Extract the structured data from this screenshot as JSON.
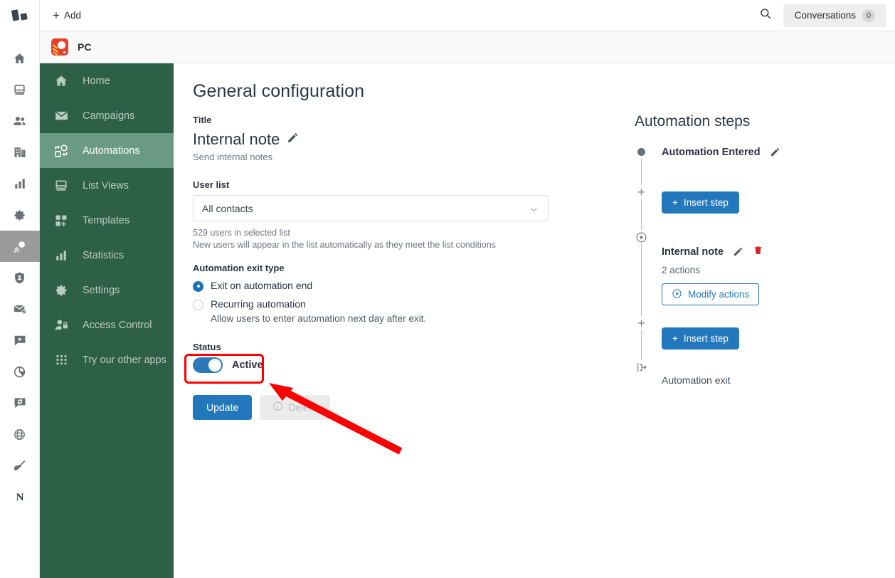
{
  "topbar": {
    "add_label": "Add",
    "search_icon": "search-icon",
    "conversations_label": "Conversations",
    "conversations_count": "0"
  },
  "app_tab": {
    "label": "PC",
    "icon": "sunrise-app-icon"
  },
  "sidebar": {
    "items": [
      {
        "label": "Home",
        "icon": "home-icon",
        "active": false
      },
      {
        "label": "Campaigns",
        "icon": "envelope-icon",
        "active": false
      },
      {
        "label": "Automations",
        "icon": "automation-icon",
        "active": true
      },
      {
        "label": "List Views",
        "icon": "list-views-icon",
        "active": false
      },
      {
        "label": "Templates",
        "icon": "templates-icon",
        "active": false
      },
      {
        "label": "Statistics",
        "icon": "bar-chart-icon",
        "active": false
      },
      {
        "label": "Settings",
        "icon": "gear-icon",
        "active": false
      },
      {
        "label": "Access Control",
        "icon": "user-lock-icon",
        "active": false
      },
      {
        "label": "Try our other apps",
        "icon": "grid-dots-icon",
        "active": false
      }
    ]
  },
  "rail": {
    "logo": "blocks-logo",
    "items": [
      {
        "icon": "home-icon",
        "active": false
      },
      {
        "icon": "database-icon",
        "active": false
      },
      {
        "icon": "people-icon",
        "active": false
      },
      {
        "icon": "company-icon",
        "active": false
      },
      {
        "icon": "bar-chart-icon",
        "active": false
      },
      {
        "icon": "gear-icon",
        "active": false
      },
      {
        "icon": "automation-rocket-icon",
        "active": true
      },
      {
        "icon": "shield-user-icon",
        "active": false
      },
      {
        "icon": "mail-check-icon",
        "active": false
      },
      {
        "icon": "video-chat-icon",
        "active": false
      },
      {
        "icon": "pie-chart-icon",
        "active": false
      },
      {
        "icon": "chat-refresh-icon",
        "active": false
      },
      {
        "icon": "globe-icon",
        "active": false
      },
      {
        "icon": "broom-icon",
        "active": false
      },
      {
        "icon": "letter-n-icon",
        "active": false
      }
    ]
  },
  "main": {
    "page_title": "General configuration",
    "title_field_label": "Title",
    "title_value": "Internal note",
    "title_edit_icon": "pencil-icon",
    "title_subtitle": "Send internal notes",
    "user_list_label": "User list",
    "user_list_value": "All contacts",
    "user_list_caret": "chevron-down-icon",
    "helper_line1": "529 users in selected list",
    "helper_line2": "New users will appear in the list automatically as they meet the list conditions",
    "exit_type_label": "Automation exit type",
    "exit_options": [
      {
        "label": "Exit on automation end",
        "selected": true,
        "sub": ""
      },
      {
        "label": "Recurring automation",
        "selected": false,
        "sub": "Allow users to enter automation next day after exit."
      }
    ],
    "status_label": "Status",
    "status_toggle_on": true,
    "status_text": "Active",
    "update_label": "Update",
    "delete_label": "Delete",
    "delete_icon": "info-circle-icon"
  },
  "steps_panel": {
    "title": "Automation steps",
    "entered": {
      "name": "Automation Entered",
      "node_icon": "filled-dot-icon",
      "edit_icon": "pencil-icon"
    },
    "insert_step_label": "Insert step",
    "insert_plus_icon": "plus-icon",
    "step": {
      "name": "Internal note",
      "node_icon": "play-circle-icon",
      "edit_icon": "pencil-icon",
      "delete_icon": "trash-icon",
      "actions_count": "2 actions",
      "modify_label": "Modify actions",
      "modify_icon": "play-circle-icon"
    },
    "exit": {
      "label": "Automation exit",
      "icon": "exit-door-icon"
    }
  },
  "annotations": {
    "highlight_color": "#ff0000",
    "arrow_color": "#ff0000"
  },
  "colors": {
    "sidebar_green": "#2e6047",
    "sidebar_active_green": "#6b9a84",
    "primary_blue": "#2378bd",
    "toggle_blue": "#2a7ab9",
    "app_icon_red": "#e8402a",
    "trash_red": "#d8232a"
  }
}
